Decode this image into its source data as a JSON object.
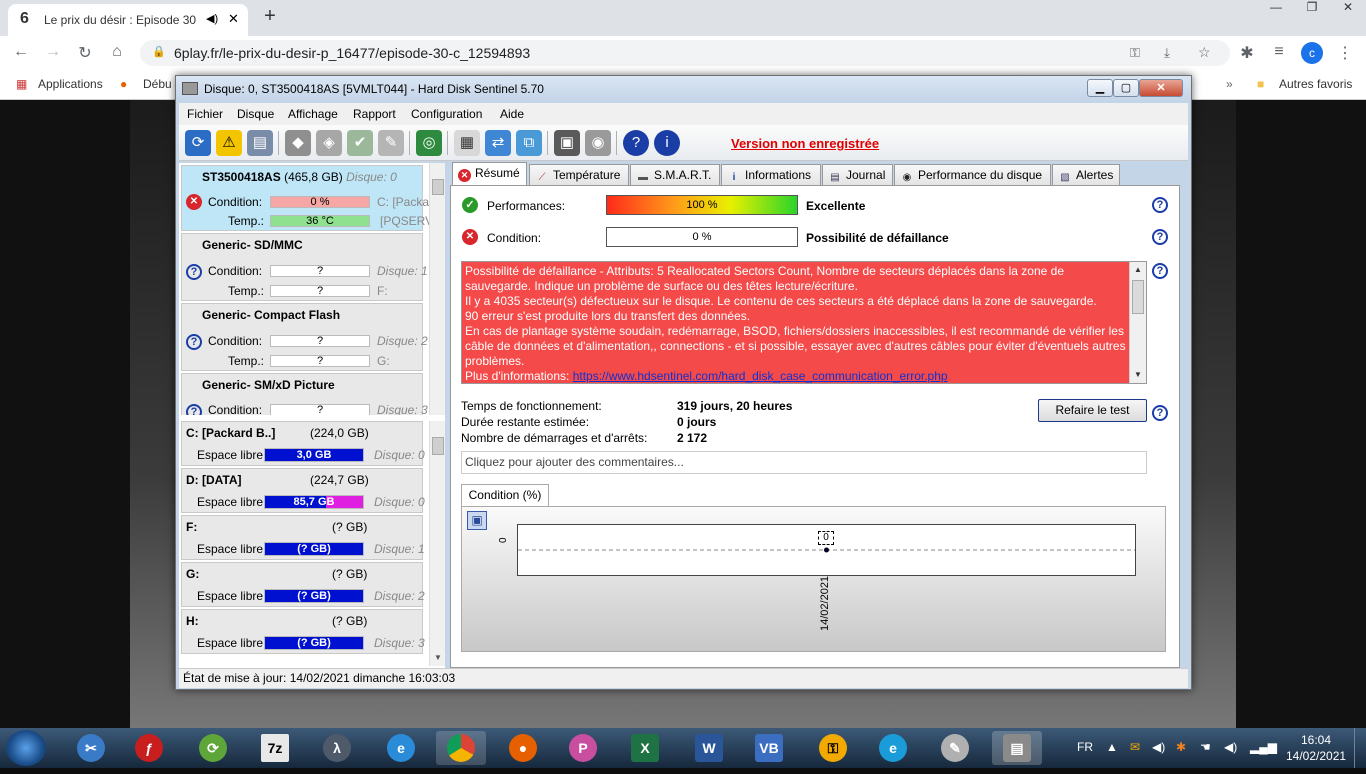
{
  "browser": {
    "tab_title": "Le prix du désir : Episode 30",
    "tab_favicon": "6",
    "url": "6play.fr/le-prix-du-desir-p_16477/episode-30-c_12594893",
    "profile_letter": "c",
    "bookmarks": {
      "apps": "Applications",
      "first": "Débu",
      "other": "Autres favoris"
    }
  },
  "window": {
    "title": "Disque: 0, ST3500418AS [5VMLT044]  -  Hard Disk Sentinel 5.70"
  },
  "menu": {
    "fichier": "Fichier",
    "disque": "Disque",
    "affichage": "Affichage",
    "rapport": "Rapport",
    "configuration": "Configuration",
    "aide": "Aide"
  },
  "toolbar": {
    "unregistered": "Version non enregistrée"
  },
  "disks": [
    {
      "name": "ST3500418AS",
      "size": "(465,8 GB)",
      "disk": "Disque: 0",
      "cond_label": "Condition:",
      "cond": "0 %",
      "cond_side": "C: [Packa",
      "temp_label": "Temp.:",
      "temp": "36 °C",
      "temp_side": "[PQSERV"
    },
    {
      "name": "Generic- SD/MMC",
      "cond_label": "Condition:",
      "cond": "?",
      "cond_side": "Disque: 1",
      "temp_label": "Temp.:",
      "temp": "?",
      "temp_side": "F:"
    },
    {
      "name": "Generic- Compact Flash",
      "cond_label": "Condition:",
      "cond": "?",
      "cond_side": "Disque: 2",
      "temp_label": "Temp.:",
      "temp": "?",
      "temp_side": "G:"
    },
    {
      "name": "Generic- SM/xD Picture",
      "cond_label": "Condition:",
      "cond": "?",
      "cond_side": "Disque: 3"
    }
  ],
  "volumes": [
    {
      "name": "C: [Packard B..]",
      "size": "(224,0 GB)",
      "free_label": "Espace libre",
      "free": "3,0 GB",
      "disk": "Disque: 0"
    },
    {
      "name": "D: [DATA]",
      "size": "(224,7 GB)",
      "free_label": "Espace libre",
      "free": "85,7 GB",
      "disk": "Disque: 0"
    },
    {
      "name": "F:",
      "size": "(? GB)",
      "free_label": "Espace libre",
      "free": "(? GB)",
      "disk": "Disque: 1"
    },
    {
      "name": "G:",
      "size": "(? GB)",
      "free_label": "Espace libre",
      "free": "(? GB)",
      "disk": "Disque: 2"
    },
    {
      "name": "H:",
      "size": "(? GB)",
      "free_label": "Espace libre",
      "free": "(? GB)",
      "disk": "Disque: 3"
    }
  ],
  "tabs": [
    "Résumé",
    "Température",
    "S.M.A.R.T.",
    "Informations",
    "Journal",
    "Performance du disque",
    "Alertes"
  ],
  "summary": {
    "perf_label": "Performances:",
    "perf_value": "100 %",
    "perf_fraction": 1.0,
    "perf_verdict": "Excellente",
    "cond_label": "Condition:",
    "cond_value": "0 %",
    "cond_verdict": "Possibilité de défaillance",
    "message": [
      "Possibilité de défaillance - Attributs: 5 Reallocated Sectors Count, Nombre de secteurs déplacés dans la zone de sauvegarde. Indique un problème de surface ou des têtes lecture/écriture.",
      "Il y a 4035 secteur(s) défectueux sur le disque. Le contenu de ces secteurs a été déplacé dans la zone de sauvegarde.",
      "90 erreur s'est produite lors du transfert des données.",
      "En cas de plantage système soudain, redémarrage, BSOD, fichiers/dossiers inaccessibles, il est recommandé de vérifier les câble de données et d'alimentation,, connections - et si possible, essayer avec d'autres câbles pour éviter d'éventuels autres problèmes."
    ],
    "more_info_label": "Plus d'informations:",
    "more_info_link": "https://www.hdsentinel.com/hard_disk_case_communication_error.php",
    "uptime_label": "Temps de fonctionnement:",
    "uptime": "319 jours, 20 heures",
    "remaining_label": "Durée restante estimée:",
    "remaining": "0 jours",
    "starts_label": "Nombre de démarrages et d'arrêts:",
    "starts": "2 172",
    "retest_button": "Refaire le test",
    "comment_placeholder": "Cliquez pour ajouter des commentaires...",
    "chart_tab": "Condition (%)"
  },
  "chart_data": {
    "type": "line",
    "title": "",
    "x": [
      "14/02/2021"
    ],
    "series": [
      {
        "values": [
          0
        ]
      }
    ],
    "ytick": "0",
    "point_label": "0"
  },
  "status": "État de mise à jour: 14/02/2021 dimanche 16:03:03",
  "taskbar": {
    "lang": "FR",
    "time": "16:04",
    "date": "14/02/2021"
  }
}
